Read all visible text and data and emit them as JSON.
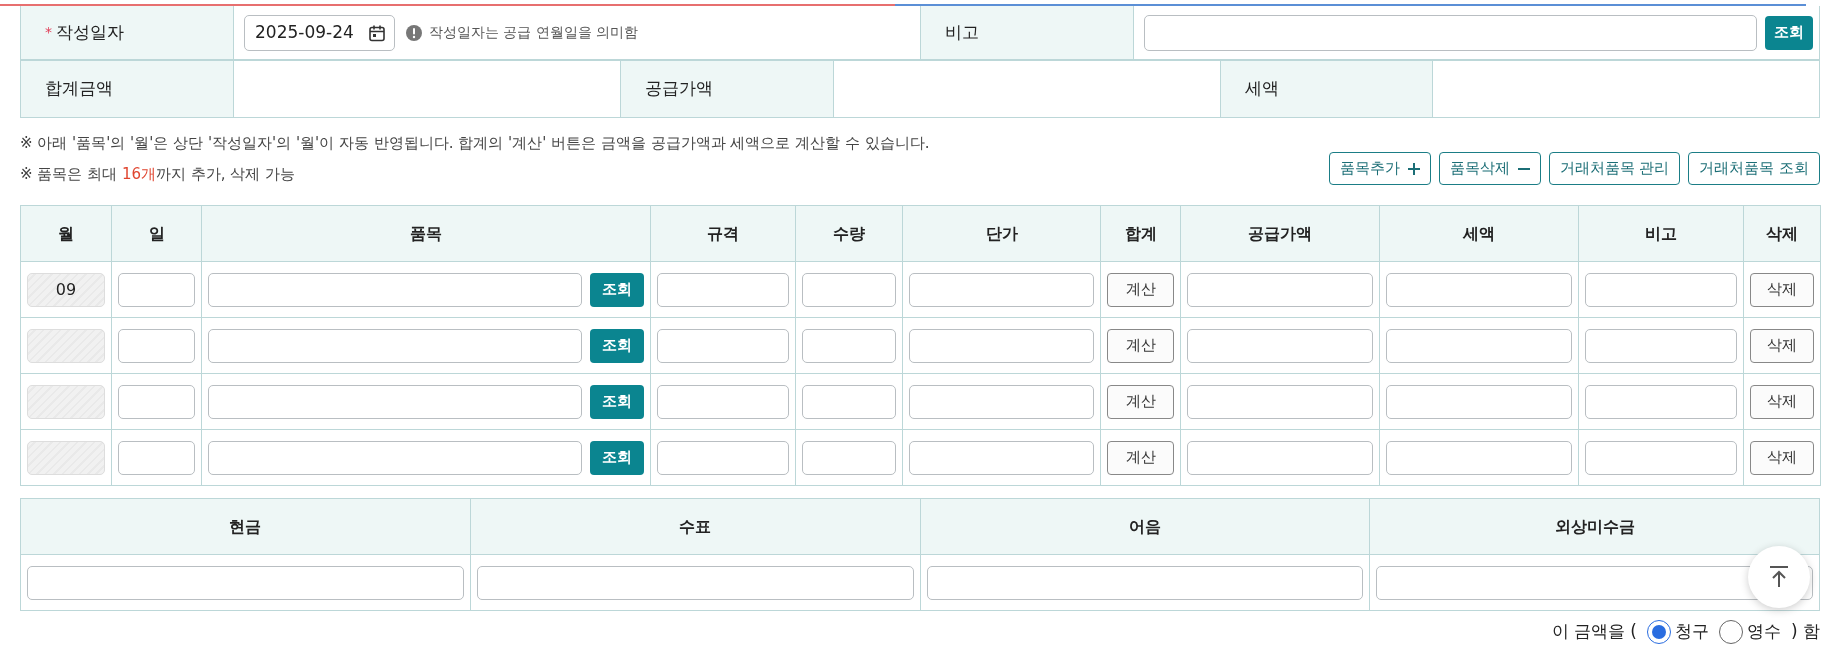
{
  "top_form": {
    "required_mark": "*",
    "date_label": "작성일자",
    "date_value": "2025-09-24",
    "date_hint": "작성일자는 공급 연월일을 의미함",
    "remark_label": "비고",
    "lookup_button": "조회",
    "total_label": "합계금액",
    "supply_label": "공급가액",
    "tax_label": "세액"
  },
  "notes": [
    {
      "parts": [
        {
          "text": "※ 아래 '품목'의 '월'은 상단 '작성일자'의 '월'이 자동 반영됩니다. 합계의 '계산' 버튼은 금액을 공급가액과 세액으로 계산할 수 있습니다.",
          "highlight": false
        }
      ]
    },
    {
      "parts": [
        {
          "text": "※ 품목은 최대 ",
          "highlight": false
        },
        {
          "text": "16개",
          "highlight": true
        },
        {
          "text": "까지 추가, 삭제 가능",
          "highlight": false
        }
      ]
    }
  ],
  "toolbar": [
    {
      "label": "품목추가",
      "kind": "add"
    },
    {
      "label": "품목삭제",
      "kind": "remove"
    },
    {
      "label": "거래처품목 관리",
      "kind": "plain"
    },
    {
      "label": "거래처품목 조회",
      "kind": "plain"
    }
  ],
  "items_table": {
    "columns": [
      "월",
      "일",
      "품목",
      "규격",
      "수량",
      "단가",
      "합계",
      "공급가액",
      "세액",
      "비고",
      "삭제"
    ],
    "rows": [
      {
        "month": "09",
        "lookup_button": "조회",
        "calc_button": "계산",
        "delete_button": "삭제"
      },
      {
        "lookup_button": "조회",
        "calc_button": "계산",
        "delete_button": "삭제"
      },
      {
        "lookup_button": "조회",
        "calc_button": "계산",
        "delete_button": "삭제"
      },
      {
        "lookup_button": "조회",
        "calc_button": "계산",
        "delete_button": "삭제"
      }
    ]
  },
  "payment_table": {
    "columns": [
      "현금",
      "수표",
      "어음",
      "외상미수금"
    ]
  },
  "amount_choice": {
    "prefix": "이 금액을 (",
    "options": [
      {
        "label": "청구",
        "selected": true
      },
      {
        "label": "영수",
        "selected": false
      }
    ],
    "suffix": ") 함"
  }
}
